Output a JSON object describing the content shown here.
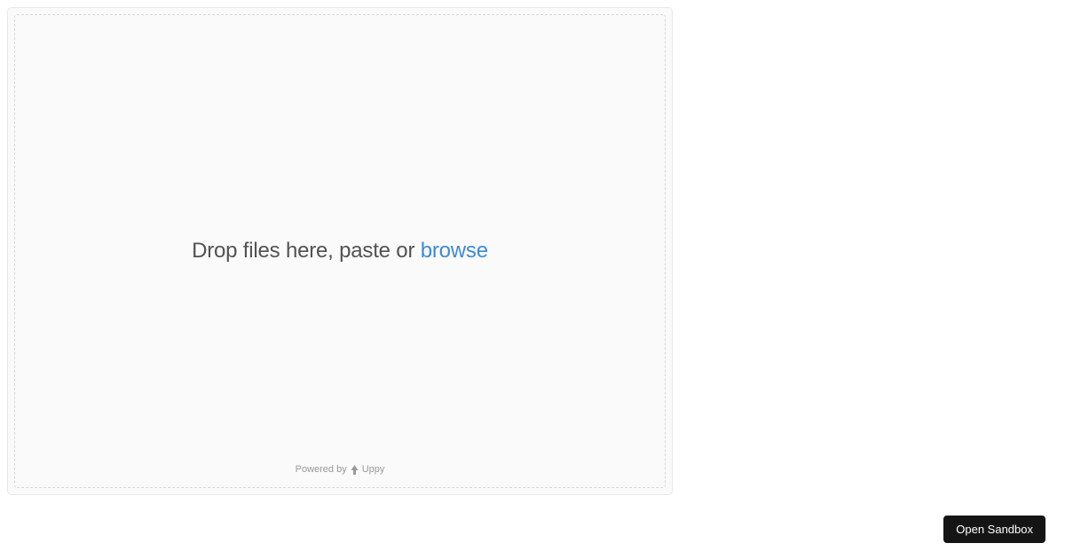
{
  "dashboard": {
    "drop_text_prefix": "Drop files here, paste or ",
    "browse_label": "browse"
  },
  "footer": {
    "powered_by_prefix": "Powered by",
    "brand_name": "Uppy"
  },
  "sandbox_button": {
    "label": "Open Sandbox"
  }
}
